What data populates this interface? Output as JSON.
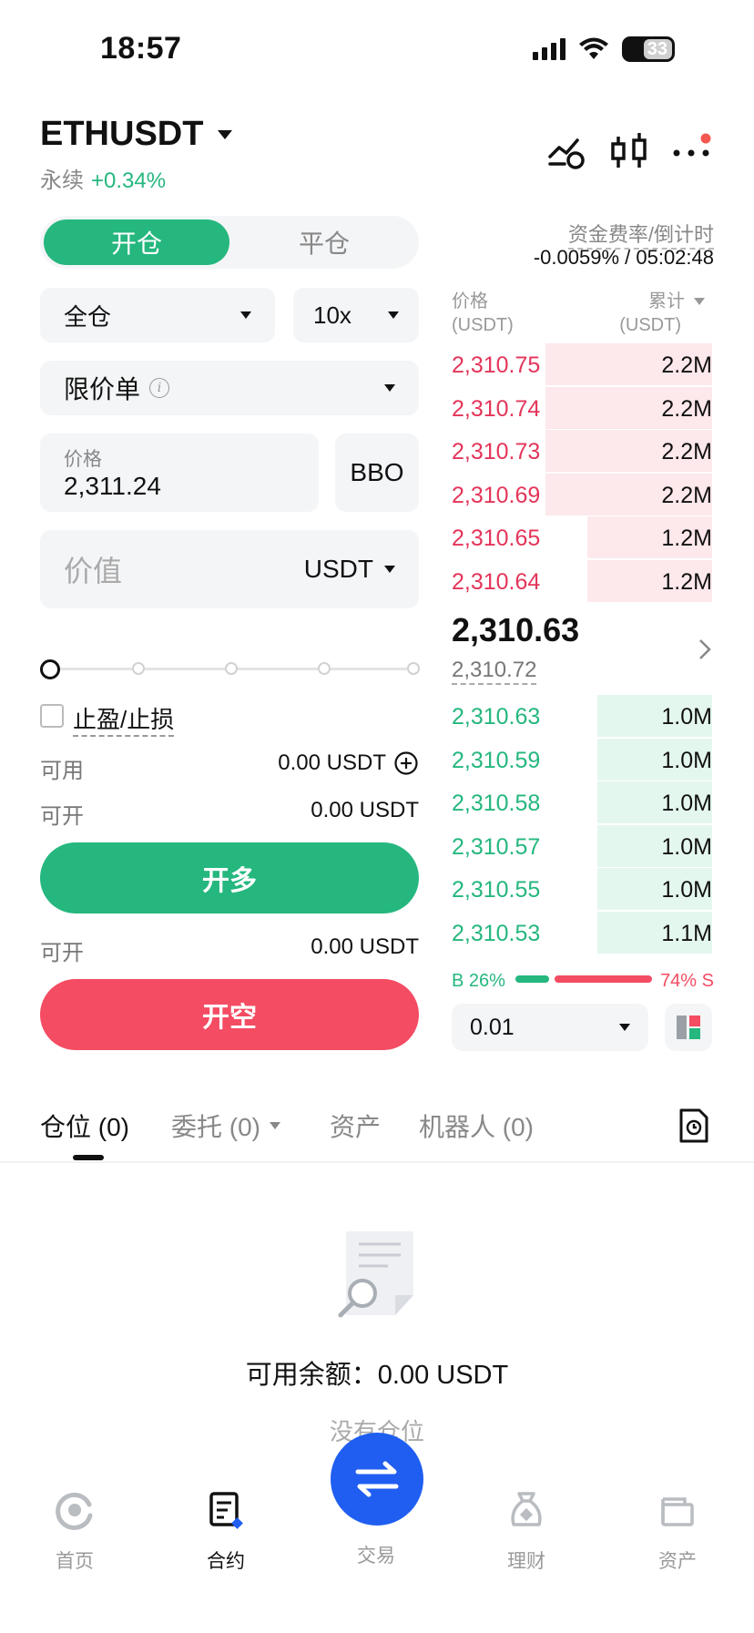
{
  "status_bar": {
    "time": "18:57",
    "battery": "33"
  },
  "header": {
    "symbol": "ETHUSDT",
    "contract_type": "永续",
    "change": "+0.34%"
  },
  "funding": {
    "label": "资金费率/倒计时",
    "value": "-0.0059% / 05:02:48"
  },
  "order_form": {
    "tab_open": "开仓",
    "tab_close": "平仓",
    "margin_mode": "全仓",
    "leverage": "10x",
    "order_type": "限价单",
    "price_label": "价格",
    "price_value": "2,311.24",
    "bbo": "BBO",
    "value_placeholder": "价值",
    "value_unit": "USDT",
    "tpsl_label": "止盈/止损",
    "available_label": "可用",
    "available_value": "0.00 USDT",
    "can_open_label": "可开",
    "can_open_long": "0.00 USDT",
    "can_open_short": "0.00 USDT",
    "long_button": "开多",
    "short_button": "开空"
  },
  "order_book": {
    "price_header": "价格",
    "price_unit": "(USDT)",
    "total_header": "累计",
    "total_unit": "(USDT)",
    "asks": [
      {
        "price": "2,310.75",
        "amount": "2.2M",
        "depth": 0.64
      },
      {
        "price": "2,310.74",
        "amount": "2.2M",
        "depth": 0.64
      },
      {
        "price": "2,310.73",
        "amount": "2.2M",
        "depth": 0.64
      },
      {
        "price": "2,310.69",
        "amount": "2.2M",
        "depth": 0.64
      },
      {
        "price": "2,310.65",
        "amount": "1.2M",
        "depth": 0.48
      },
      {
        "price": "2,310.64",
        "amount": "1.2M",
        "depth": 0.48
      }
    ],
    "last_price": "2,310.63",
    "mark_price": "2,310.72",
    "bids": [
      {
        "price": "2,310.63",
        "amount": "1.0M",
        "depth": 0.44
      },
      {
        "price": "2,310.59",
        "amount": "1.0M",
        "depth": 0.44
      },
      {
        "price": "2,310.58",
        "amount": "1.0M",
        "depth": 0.44
      },
      {
        "price": "2,310.57",
        "amount": "1.0M",
        "depth": 0.44
      },
      {
        "price": "2,310.55",
        "amount": "1.0M",
        "depth": 0.44
      },
      {
        "price": "2,310.53",
        "amount": "1.1M",
        "depth": 0.44
      }
    ],
    "buy_ratio": "B 26%",
    "sell_ratio": "74% S",
    "buy_fraction": 0.26,
    "precision": "0.01"
  },
  "tabs": [
    {
      "label": "仓位 (0)"
    },
    {
      "label": "委托 (0)"
    },
    {
      "label": "资产"
    },
    {
      "label": "机器人 (0)"
    }
  ],
  "empty_state": {
    "balance": "可用余额：0.00 USDT",
    "message": "没有仓位"
  },
  "bottom_nav": [
    {
      "label": "首页"
    },
    {
      "label": "合约"
    },
    {
      "label": "交易"
    },
    {
      "label": "理财"
    },
    {
      "label": "资产"
    }
  ],
  "colors": {
    "green": "#25b77e",
    "red": "#f44c63",
    "ask_red": "#e4355a",
    "blue": "#1f5ef0"
  }
}
